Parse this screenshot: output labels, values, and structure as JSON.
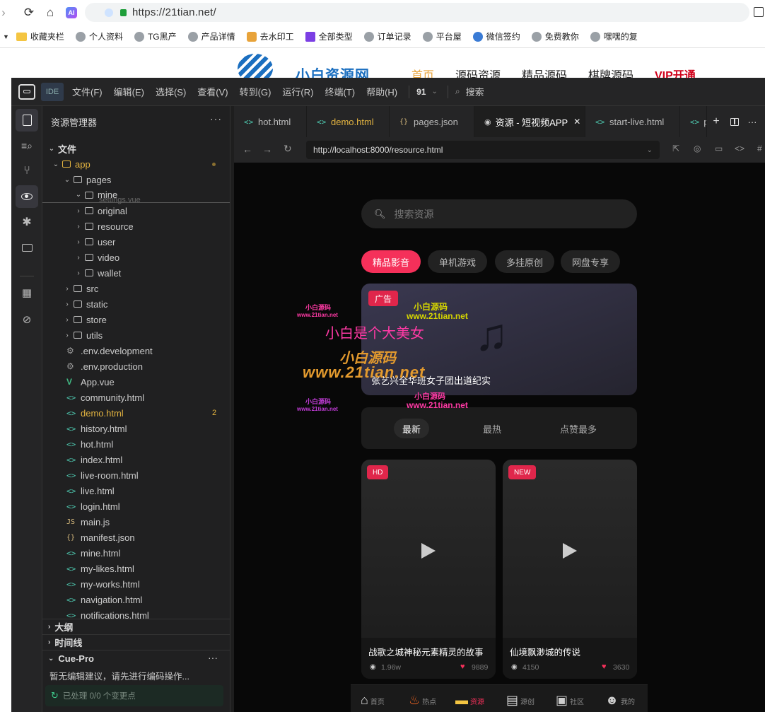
{
  "browser": {
    "url": "https://21tian.net/",
    "bookmarks": [
      "收藏夹栏",
      "个人资料",
      "TG黑产",
      "产品详情",
      "去水印工",
      "全部类型",
      "订单记录",
      "平台屋",
      "微信签约",
      "免费教你",
      "嘿嘿的复"
    ]
  },
  "site": {
    "name": "小白资源网",
    "nav": [
      "首页",
      "源码资源",
      "精品源码",
      "棋牌源码",
      "VIP开通"
    ]
  },
  "ide": {
    "badge": "IDE",
    "menu": [
      "文件(F)",
      "编辑(E)",
      "选择(S)",
      "查看(V)",
      "转到(G)",
      "运行(R)",
      "终端(T)",
      "帮助(H)"
    ],
    "counter": "91",
    "search_label": "搜索",
    "explorer_title": "资源管理器",
    "tree": [
      {
        "label": "文件",
        "type": "section"
      },
      {
        "label": "app",
        "type": "folder-open"
      },
      {
        "label": "pages",
        "type": "folder-open"
      },
      {
        "label": "mine",
        "type": "folder-open"
      },
      {
        "label": "original",
        "type": "folder"
      },
      {
        "label": "resource",
        "type": "folder"
      },
      {
        "label": "user",
        "type": "folder"
      },
      {
        "label": "video",
        "type": "folder"
      },
      {
        "label": "wallet",
        "type": "folder"
      },
      {
        "label": "src",
        "type": "folder"
      },
      {
        "label": "static",
        "type": "folder"
      },
      {
        "label": "store",
        "type": "folder"
      },
      {
        "label": "utils",
        "type": "folder"
      },
      {
        "label": ".env.development",
        "type": "gear"
      },
      {
        "label": ".env.production",
        "type": "gear"
      },
      {
        "label": "App.vue",
        "type": "vue"
      },
      {
        "label": "community.html",
        "type": "html"
      },
      {
        "label": "demo.html",
        "type": "html"
      },
      {
        "label": "history.html",
        "type": "html"
      },
      {
        "label": "hot.html",
        "type": "html"
      },
      {
        "label": "index.html",
        "type": "html"
      },
      {
        "label": "live-room.html",
        "type": "html"
      },
      {
        "label": "live.html",
        "type": "html"
      },
      {
        "label": "login.html",
        "type": "html"
      },
      {
        "label": "main.js",
        "type": "js"
      },
      {
        "label": "manifest.json",
        "type": "json"
      },
      {
        "label": "mine.html",
        "type": "html"
      },
      {
        "label": "my-likes.html",
        "type": "html"
      },
      {
        "label": "my-works.html",
        "type": "html"
      },
      {
        "label": "navigation.html",
        "type": "html"
      },
      {
        "label": "notifications.html",
        "type": "html"
      }
    ],
    "demo_badge": "2",
    "outline": "大纲",
    "timeline": "时间线",
    "cue_title": "Cue-Pro",
    "cue_hint": "暂无编辑建议，请先进行编码操作...",
    "cue_status": "已处理 0/0 个变更点",
    "tabs": [
      "hot.html",
      "demo.html",
      "pages.json",
      "资源 - 短视频APP",
      "start-live.html",
      "pr"
    ],
    "preview_url": "http://localhost:8000/resource.html"
  },
  "app": {
    "search_placeholder": "搜索资源",
    "categories": [
      "精品影音",
      "单机游戏",
      "多挂原创",
      "网盘专享"
    ],
    "ad_badge": "广告",
    "banner_title": "张艺兴全华班女子团出道纪实",
    "sorts": [
      "最新",
      "最热",
      "点赞最多"
    ],
    "videos": [
      {
        "badge": "HD",
        "title": "战歌之城神秘元素精灵的故事",
        "views": "1.96w",
        "likes": "9889"
      },
      {
        "badge": "NEW",
        "title": "仙境飘渺城的传说",
        "views": "4150",
        "likes": "3630"
      }
    ],
    "bottom_nav": [
      "首页",
      "热点",
      "资源",
      "源创",
      "社区",
      "我的"
    ]
  },
  "watermarks": [
    "小白源码",
    "www.21tian.net",
    "小白是个大美女",
    "小白源码",
    "www.21tian.net"
  ],
  "colors": {
    "accent": "#f5305a",
    "ide_bg": "#1e1e1e",
    "folder_accent": "#e5a93a"
  }
}
